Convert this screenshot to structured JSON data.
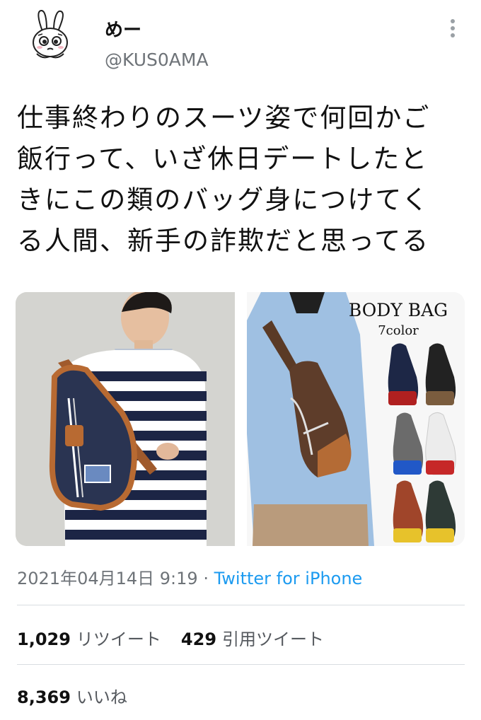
{
  "author": {
    "display_name": "めー",
    "handle": "@KUS0AMA"
  },
  "tweet": {
    "text_lines": [
      "仕事終わりのスーツ姿で何回かご",
      "飯行って、いざ休日デートしたと",
      "きにこの類のバッグ身につけてく",
      "る人間、新手の詐欺だと思ってる"
    ],
    "media": {
      "left_photo": {
        "description_icon": "sling-bag-photo"
      },
      "right_photo": {
        "ad_title": "BODY BAG",
        "ad_subtitle": "7color"
      }
    },
    "timestamp": "2021年04月14日 9:19",
    "separator": "·",
    "source": "Twitter for iPhone"
  },
  "stats": {
    "retweets_count": "1,029",
    "retweets_label": "リツイート",
    "quotes_count": "429",
    "quotes_label": "引用ツイート",
    "likes_count": "8,369",
    "likes_label": "いいね"
  },
  "colors": {
    "link": "#1d9bf0",
    "secondary_text": "#6e7378",
    "divider": "#d8dde1"
  }
}
